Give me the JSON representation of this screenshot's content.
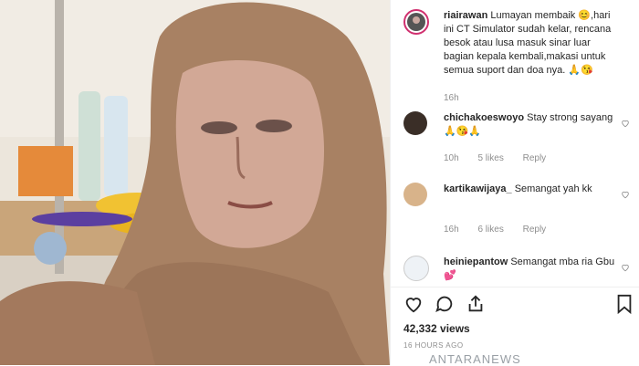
{
  "post": {
    "author": "riairawan",
    "caption": "Lumayan membaik 😊,hari ini CT Simulator sudah kelar, rencana besok atau lusa masuk sinar luar bagian kepala kembali,makasi untuk semua suport dan doa nya. 🙏😘",
    "time": "16h"
  },
  "comments": [
    {
      "user": "chichakoeswoyo",
      "text": "Stay strong sayang🙏😘🙏",
      "time": "10h",
      "likes": "5 likes",
      "reply": "Reply"
    },
    {
      "user": "kartikawijaya_",
      "text": "Semangat yah kk",
      "time": "16h",
      "likes": "6 likes",
      "reply": "Reply"
    },
    {
      "user": "heiniepantow",
      "text": "Semangat mba ria Gbu💕",
      "time": "",
      "likes": "",
      "reply": ""
    }
  ],
  "views": "42,332 views",
  "posted_ago": "16 HOURS AGO",
  "watermark": "ANTARANEWS",
  "icons": [
    "heart-icon",
    "comment-icon",
    "share-icon",
    "bookmark-icon"
  ]
}
